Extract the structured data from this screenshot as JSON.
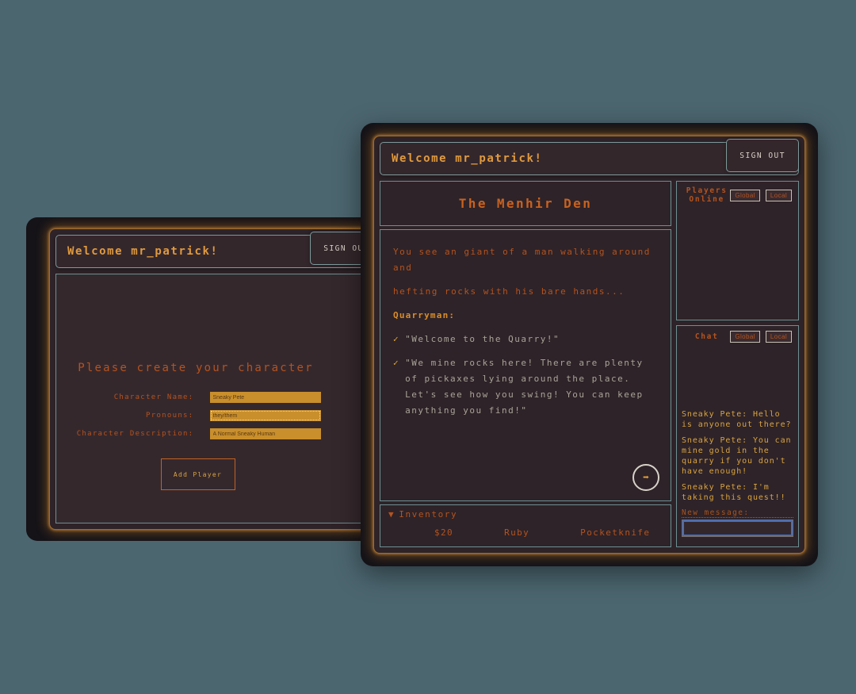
{
  "front_window": {
    "header": {
      "welcome": "Welcome mr_patrick!",
      "sign_out_label": "SIGN OUT"
    },
    "location_title": "The Menhir Den",
    "story": {
      "narration": [
        "You see an giant of a man walking around and",
        "hefting rocks with his bare hands..."
      ],
      "speaker": "Quarryman:",
      "options": [
        {
          "check": "✓",
          "text": "\"Welcome to the Quarry!\""
        },
        {
          "check": "✓",
          "text": "\"We mine rocks here! There are plenty of pickaxes lying around the place. Let's see how you swing! You can keep anything you find!\""
        }
      ],
      "next_icon": "➡"
    },
    "inventory": {
      "toggle_icon": "▼",
      "label": "Inventory",
      "items": [
        "$20",
        "Ruby",
        "Pocketknife"
      ]
    },
    "players_online": {
      "title": "Players\nOnline",
      "title_line1": "Players",
      "title_line2": "Online",
      "global_label": "Global",
      "local_label": "Local",
      "entries": []
    },
    "chat": {
      "title": "Chat",
      "global_label": "Global",
      "local_label": "Local",
      "messages": [
        "Sneaky Pete: Hello is anyone out there?",
        "Sneaky Pete: You can mine gold in the quarry if you don't have enough!",
        "Sneaky Pete: I'm taking this quest!!"
      ],
      "new_message_label": "New message:",
      "input_value": "",
      "input_placeholder": ""
    }
  },
  "back_window": {
    "header": {
      "welcome": "Welcome mr_patrick!",
      "sign_out_label": "SIGN OUT"
    },
    "title": "Please create your character",
    "fields": [
      {
        "label": "Character Name:",
        "value": "Sneaky Pete"
      },
      {
        "label": "Pronouns:",
        "value": "they/them"
      },
      {
        "label": "Character Description:",
        "value": "A Normal Sneaky Human"
      }
    ],
    "submit_label": "Add Player"
  },
  "colors": {
    "page_bg": "#4c6670",
    "device_bg": "#151318",
    "panel_bg": "#2e2328",
    "border_teal": "#6d8f92",
    "accent_orange": "#c9621f",
    "accent_gold": "#d9a441",
    "input_gold": "#c98f2c",
    "focus_blue": "#3b6fd4"
  }
}
